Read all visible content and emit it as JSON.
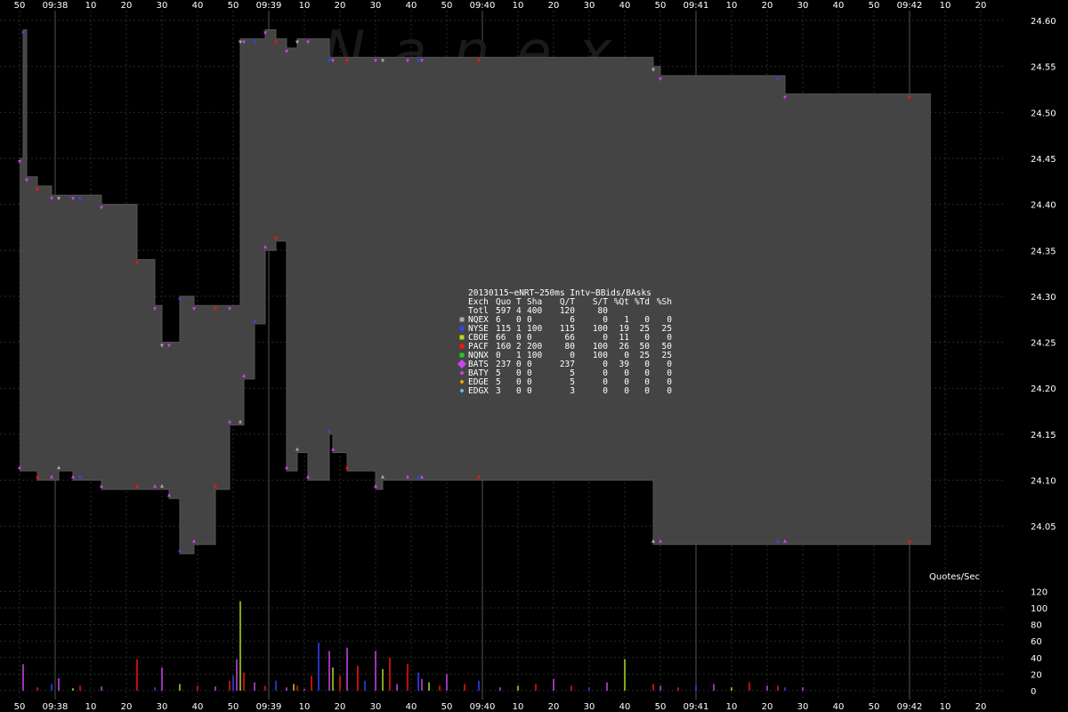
{
  "chart_data": [
    {
      "type": "area",
      "panel": "price",
      "watermark": "Nanex",
      "title": "20130115~eNRT~250ms Intv~BBids/BAsks",
      "ylim": [
        24.01,
        24.62
      ],
      "y_ticks": [
        "24.60",
        "24.55",
        "24.50",
        "24.45",
        "24.40",
        "24.35",
        "24.30",
        "24.25",
        "24.20",
        "24.15",
        "24.10",
        "24.05"
      ],
      "x_ticks": [
        "50",
        "09:38",
        "10",
        "20",
        "30",
        "40",
        "50",
        "09:39",
        "10",
        "20",
        "30",
        "40",
        "50",
        "09:40",
        "10",
        "20",
        "30",
        "40",
        "50",
        "09:41",
        "10",
        "20",
        "30",
        "40",
        "50",
        "09:42",
        "10",
        "20"
      ],
      "x_unit": "seconds after 09:37:50",
      "grid": true,
      "series": [
        {
          "name": "Best Ask",
          "x": [
            0,
            1,
            2,
            5,
            9,
            11,
            15,
            17,
            23,
            33,
            38,
            40,
            42,
            45,
            49,
            55,
            59,
            62,
            63,
            66,
            69,
            72,
            75,
            78,
            81,
            87,
            88,
            92,
            100,
            102,
            109,
            112,
            113,
            129,
            178,
            178,
            180,
            213,
            215,
            250
          ],
          "values": [
            24.45,
            24.59,
            24.43,
            24.42,
            24.41,
            24.41,
            24.41,
            24.41,
            24.4,
            24.34,
            24.29,
            24.25,
            24.25,
            24.3,
            24.29,
            24.29,
            24.29,
            24.58,
            24.58,
            24.58,
            24.59,
            24.58,
            24.57,
            24.58,
            24.58,
            24.56,
            24.56,
            24.56,
            24.56,
            24.56,
            24.56,
            24.56,
            24.56,
            24.56,
            24.55,
            24.55,
            24.54,
            24.54,
            24.52,
            24.52
          ]
        },
        {
          "name": "Best Bid",
          "x": [
            0,
            5,
            9,
            11,
            15,
            17,
            23,
            33,
            38,
            40,
            42,
            45,
            49,
            55,
            59,
            62,
            63,
            66,
            69,
            72,
            75,
            78,
            81,
            87,
            88,
            92,
            100,
            102,
            109,
            112,
            113,
            129,
            178,
            178,
            180,
            213,
            215,
            250
          ],
          "values": [
            24.11,
            24.1,
            24.1,
            24.11,
            24.1,
            24.1,
            24.09,
            24.09,
            24.09,
            24.09,
            24.08,
            24.02,
            24.03,
            24.09,
            24.16,
            24.16,
            24.21,
            24.27,
            24.35,
            24.36,
            24.11,
            24.13,
            24.1,
            24.15,
            24.13,
            24.11,
            24.09,
            24.1,
            24.1,
            24.1,
            24.1,
            24.1,
            24.03,
            24.03,
            24.03,
            24.03,
            24.03,
            24.03
          ]
        }
      ],
      "legend_title": [
        "Exch",
        "Quo",
        "T",
        "Sha",
        "Q/T",
        "S/T",
        "%Qt",
        "%Td",
        "%Sh"
      ],
      "legend_rows": [
        {
          "name": "Totl",
          "color": "",
          "row": [
            "Totl",
            "597",
            "4",
            "400",
            "120",
            "80",
            "",
            "",
            ""
          ]
        },
        {
          "name": "NQEX",
          "color": "#aaaaaa",
          "row": [
            "NQEX",
            "6",
            "0",
            "0",
            "6",
            "0",
            "1",
            "0",
            "0"
          ]
        },
        {
          "name": "NYSE",
          "color": "#3344ff",
          "row": [
            "NYSE",
            "115",
            "1",
            "100",
            "115",
            "100",
            "19",
            "25",
            "25"
          ]
        },
        {
          "name": "CBOE",
          "color": "#aadd22",
          "row": [
            "CBOE",
            "66",
            "0",
            "0",
            "66",
            "0",
            "11",
            "0",
            "0"
          ]
        },
        {
          "name": "PACF",
          "color": "#ff1111",
          "row": [
            "PACF",
            "160",
            "2",
            "200",
            "80",
            "100",
            "26",
            "50",
            "50"
          ]
        },
        {
          "name": "NQNX",
          "color": "#22cc22",
          "row": [
            "NQNX",
            "0",
            "1",
            "100",
            "0",
            "100",
            "0",
            "25",
            "25"
          ]
        },
        {
          "name": "BATS",
          "color": "#cc44ee",
          "row": [
            "BATS",
            "237",
            "0",
            "0",
            "237",
            "0",
            "39",
            "0",
            "0"
          ]
        },
        {
          "name": "BATY",
          "color": "#cc44ee",
          "row": [
            "BATY",
            "5",
            "0",
            "0",
            "5",
            "0",
            "0",
            "0",
            "0"
          ]
        },
        {
          "name": "EDGE",
          "color": "#ffaa00",
          "row": [
            "EDGE",
            "5",
            "0",
            "0",
            "5",
            "0",
            "0",
            "0",
            "0"
          ]
        },
        {
          "name": "EDGX",
          "color": "#55ccee",
          "row": [
            "EDGX",
            "3",
            "0",
            "0",
            "3",
            "0",
            "0",
            "0",
            "0"
          ]
        }
      ]
    },
    {
      "type": "bar",
      "panel": "volume",
      "ylabel": "Quotes/Sec",
      "ylim": [
        0,
        120
      ],
      "y_ticks": [
        "120",
        "100",
        "80",
        "60",
        "40",
        "20",
        "0"
      ],
      "series": [
        {
          "name": "Quotes/Sec",
          "x": [
            1,
            5,
            9,
            11,
            15,
            17,
            23,
            33,
            38,
            40,
            45,
            50,
            55,
            59,
            60,
            61,
            62,
            63,
            66,
            69,
            72,
            75,
            77,
            78,
            80,
            82,
            84,
            87,
            88,
            90,
            92,
            95,
            97,
            100,
            102,
            104,
            106,
            109,
            112,
            113,
            115,
            118,
            120,
            125,
            129,
            135,
            140,
            145,
            150,
            155,
            160,
            165,
            170,
            178,
            180,
            185,
            190,
            195,
            200,
            205,
            210,
            213,
            215,
            220
          ],
          "values": [
            32,
            4,
            8,
            15,
            3,
            6,
            5,
            38,
            4,
            28,
            8,
            6,
            5,
            12,
            18,
            38,
            108,
            22,
            10,
            6,
            12,
            4,
            8,
            6,
            2,
            18,
            58,
            48,
            28,
            18,
            52,
            30,
            12,
            48,
            26,
            40,
            8,
            32,
            22,
            14,
            10,
            6,
            20,
            8,
            12,
            4,
            6,
            8,
            14,
            6,
            4,
            10,
            38,
            8,
            6,
            4,
            6,
            8,
            4,
            10,
            6,
            6,
            4,
            4
          ]
        }
      ]
    }
  ]
}
